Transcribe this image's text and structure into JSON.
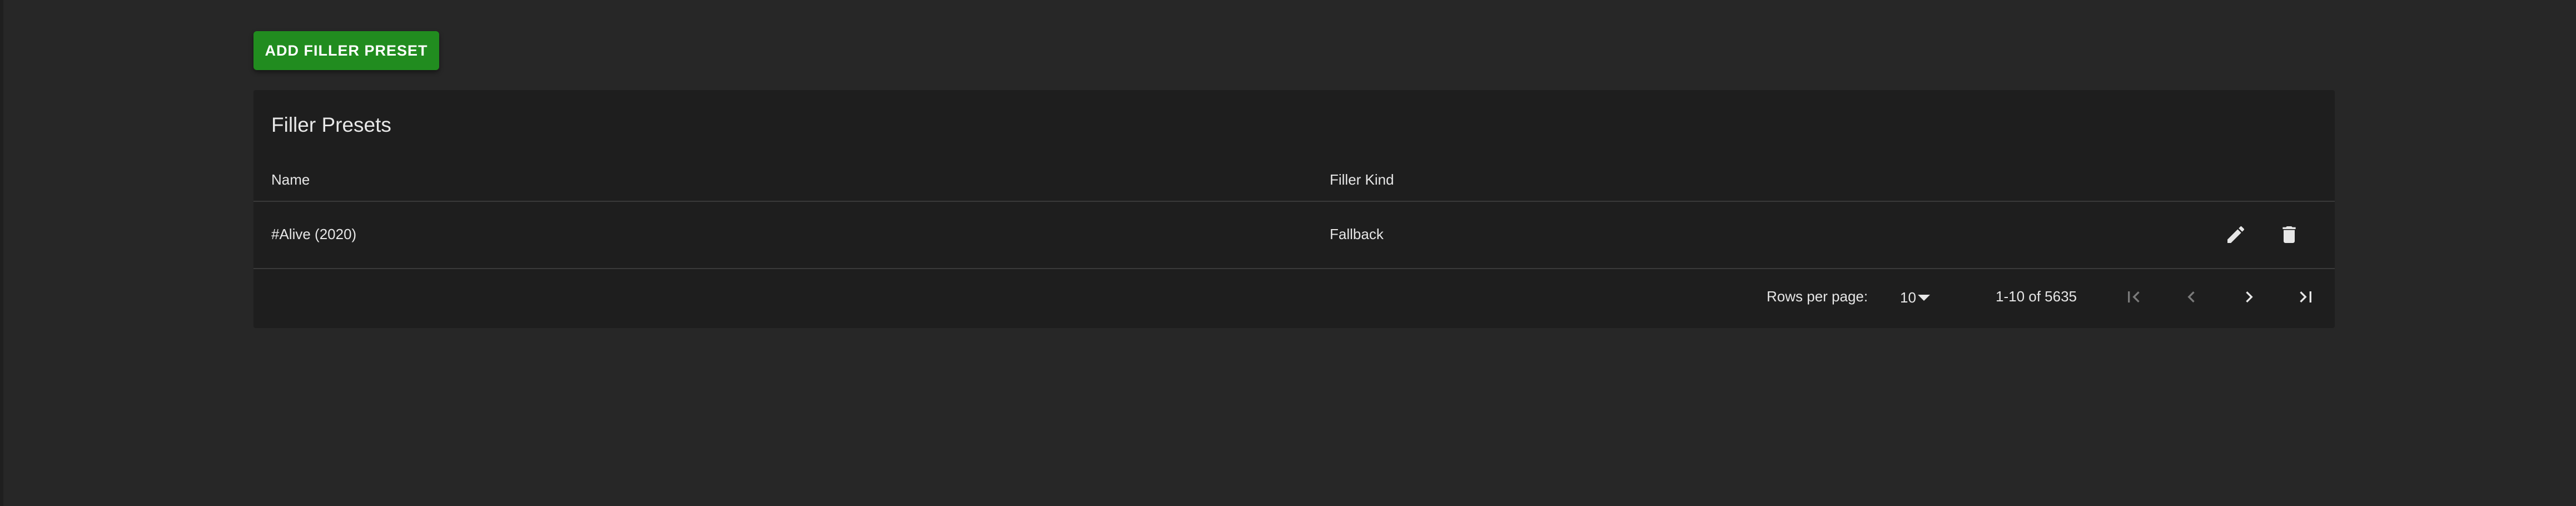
{
  "toolbar": {
    "add_label": "ADD FILLER PRESET"
  },
  "table": {
    "title": "Filler Presets",
    "columns": [
      "Name",
      "Filler Kind"
    ],
    "rows": [
      {
        "name": "#Alive (2020)",
        "kind": "Fallback"
      }
    ]
  },
  "pagination": {
    "rows_per_page_label": "Rows per page:",
    "rows_per_page_value": "10",
    "range": "1-10 of 5635"
  },
  "icons": {
    "edit": "pencil-icon",
    "delete": "trash-icon",
    "first_page": "first-page-icon",
    "prev_page": "chevron-left-icon",
    "next_page": "chevron-right-icon",
    "last_page": "last-page-icon"
  },
  "colors": {
    "background": "#272727",
    "card": "#1e1e1e",
    "accent": "#218c1f"
  }
}
